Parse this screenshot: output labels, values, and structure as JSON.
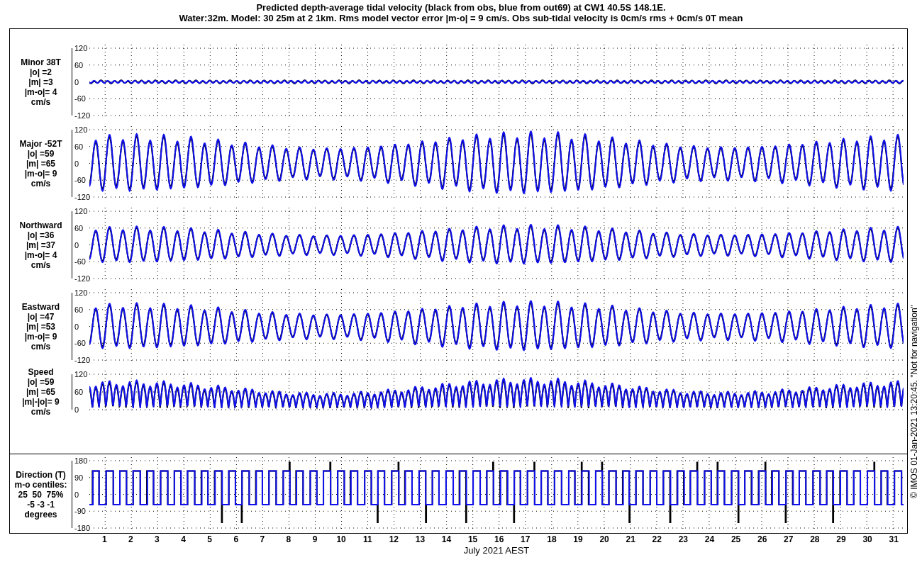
{
  "title_lines": [
    "Predicted depth-average tidal velocity (black from obs, blue from out69) at CW1 40.5S 148.1E.",
    "Water:32m. Model: 30 25m at 2 1km. Rms model vector error |m-o| = 9 cm/s. Obs sub-tidal velocity is 0cm/s rms + 0cm/s 0T mean"
  ],
  "panels": [
    {
      "kind": "minor",
      "label_lines": [
        "Minor 38T",
        "|o| =2",
        "|m| =3",
        "|m-o|= 4",
        "cm/s"
      ],
      "yticks": [
        "120",
        "60",
        "0",
        "-60",
        "-120"
      ]
    },
    {
      "kind": "major",
      "label_lines": [
        "Major -52T",
        "|o| =59",
        "|m| =65",
        "|m-o|= 9",
        "cm/s"
      ],
      "yticks": [
        "120",
        "60",
        "0",
        "-60",
        "-120"
      ]
    },
    {
      "kind": "north",
      "label_lines": [
        "Northward",
        "|o| =36",
        "|m| =37",
        "|m-o|= 4",
        "cm/s"
      ],
      "yticks": [
        "120",
        "60",
        "0",
        "-60",
        "-120"
      ]
    },
    {
      "kind": "east",
      "label_lines": [
        "Eastward",
        "|o| =47",
        "|m| =53",
        "|m-o|= 9",
        "cm/s"
      ],
      "yticks": [
        "120",
        "60",
        "0",
        "-60",
        "-120"
      ]
    },
    {
      "kind": "speed",
      "label_lines": [
        "Speed",
        "|o| =59",
        "|m| =65",
        "|m|-|o|= 9",
        "cm/s"
      ],
      "yticks": [
        "120",
        "60",
        "0"
      ]
    }
  ],
  "direction_panel": {
    "kind": "direction",
    "label_lines": [
      "Direction (T)",
      "m-o centiles:",
      "25  50  75%",
      "-5 -3 -1",
      "degrees"
    ],
    "yticks": [
      "180",
      "90",
      "0",
      "-90",
      "-180"
    ]
  },
  "xticks": [
    "1",
    "2",
    "3",
    "4",
    "5",
    "6",
    "7",
    "8",
    "9",
    "10",
    "11",
    "12",
    "13",
    "14",
    "15",
    "16",
    "17",
    "18",
    "19",
    "20",
    "21",
    "22",
    "23",
    "24",
    "25",
    "26",
    "27",
    "28",
    "29",
    "30",
    "31"
  ],
  "xlabel": "July 2021 AEST",
  "credit": "© IMOS 01-Jan-2021 13:20:45. \"Not for navigation\""
}
